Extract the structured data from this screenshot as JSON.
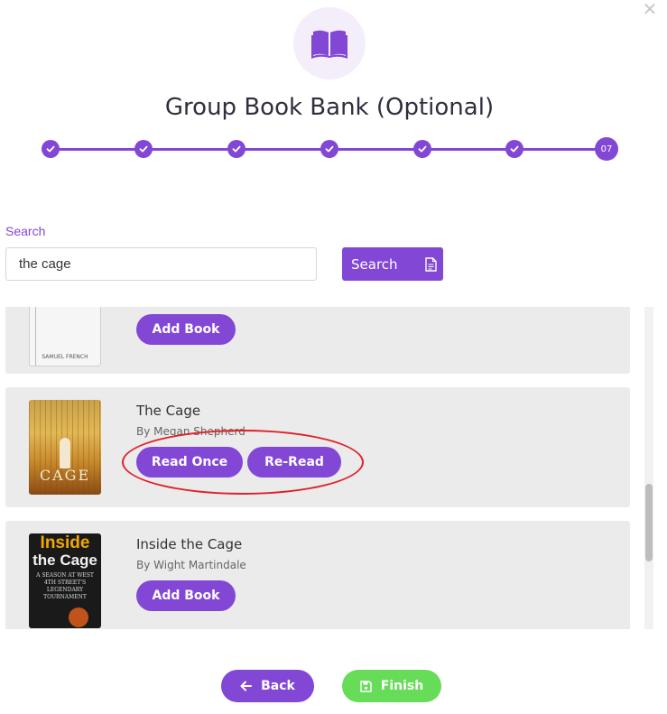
{
  "modal": {
    "title": "Group Book Bank (Optional)",
    "close_icon": "close-icon",
    "header_icon": "open-book-icon"
  },
  "stepper": {
    "completed_steps": 6,
    "current_step_label": "07"
  },
  "search": {
    "label": "Search",
    "value": "the cage",
    "button_label": "Search",
    "button_icon": "document-icon"
  },
  "books": [
    {
      "title": "",
      "author": "",
      "cover_caption": "SAMUEL FRENCH",
      "actions": [
        "Add Book"
      ]
    },
    {
      "title": "The Cage",
      "author": "By Megan Shepherd",
      "cover_caption": "CAGE",
      "actions": [
        "Read Once",
        "Re-Read"
      ]
    },
    {
      "title": "Inside the Cage",
      "author": "By Wight Martindale",
      "cover_caption_top": "Inside",
      "cover_caption_mid": "the Cage",
      "cover_caption_sub": "A SEASON AT WEST 4TH STREET'S LEGENDARY TOURNAMENT",
      "actions": [
        "Add Book"
      ]
    }
  ],
  "footer": {
    "back_label": "Back",
    "finish_label": "Finish"
  },
  "colors": {
    "accent": "#8347d6",
    "success": "#66dc58",
    "annotation": "#e0202a"
  }
}
